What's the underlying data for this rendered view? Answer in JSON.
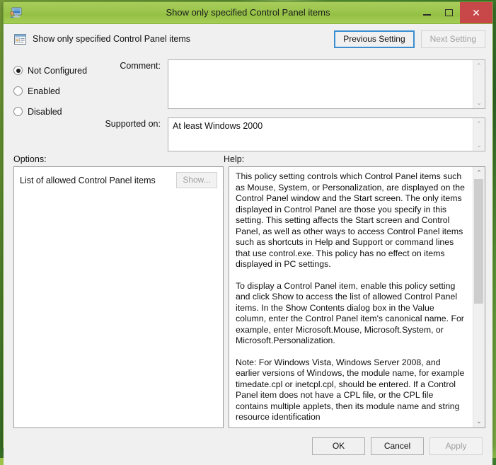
{
  "window": {
    "title": "Show only specified Control Panel items",
    "title_icon": "policy-computer-icon",
    "minimize_label": "Minimize",
    "maximize_label": "Maximize",
    "close_label": "Close",
    "close_glyph": "✕",
    "accent_titlebar": "#9cc64e",
    "accent_close": "#c8484a",
    "focus_color": "#3b8ed0"
  },
  "header": {
    "policy_icon": "policy-setting-icon",
    "policy_name": "Show only specified Control Panel items",
    "previous_setting_label": "Previous Setting",
    "next_setting_label": "Next Setting",
    "next_setting_disabled": true
  },
  "state": {
    "options": [
      {
        "label": "Not Configured",
        "selected": true
      },
      {
        "label": "Enabled",
        "selected": false
      },
      {
        "label": "Disabled",
        "selected": false
      }
    ]
  },
  "comment": {
    "label": "Comment:",
    "value": "",
    "scroll_up_glyph": "⌃",
    "scroll_down_glyph": "⌄"
  },
  "supported": {
    "label": "Supported on:",
    "value": "At least Windows 2000",
    "scroll_up_glyph": "⌃",
    "scroll_down_glyph": "⌄"
  },
  "options_panel": {
    "label": "Options:",
    "items": [
      {
        "label": "List of allowed Control Panel items",
        "button_label": "Show...",
        "button_disabled": true
      }
    ]
  },
  "help_panel": {
    "label": "Help:",
    "paragraphs": [
      "This policy setting controls which Control Panel items such as Mouse, System, or Personalization, are displayed on the Control Panel window and the Start screen. The only items displayed in Control Panel are those you specify in this setting. This setting affects the Start screen and Control Panel, as well as other ways to access Control Panel items such as shortcuts in Help and Support or command lines that use control.exe. This policy has no effect on items displayed in PC settings.",
      "To display a Control Panel item, enable this policy setting and click Show to access the list of allowed Control Panel items. In the Show Contents dialog box in the Value column, enter the Control Panel item's canonical name. For example, enter Microsoft.Mouse, Microsoft.System, or Microsoft.Personalization.",
      "Note: For Windows Vista, Windows Server 2008, and earlier versions of Windows, the module name, for example timedate.cpl or inetcpl.cpl, should be entered. If a Control Panel item does not have a CPL file, or the CPL file contains multiple applets, then its module name and string resource identification"
    ],
    "scroll_up_glyph": "⌃",
    "scroll_down_glyph": "⌄"
  },
  "footer": {
    "ok_label": "OK",
    "cancel_label": "Cancel",
    "apply_label": "Apply",
    "apply_disabled": true
  }
}
